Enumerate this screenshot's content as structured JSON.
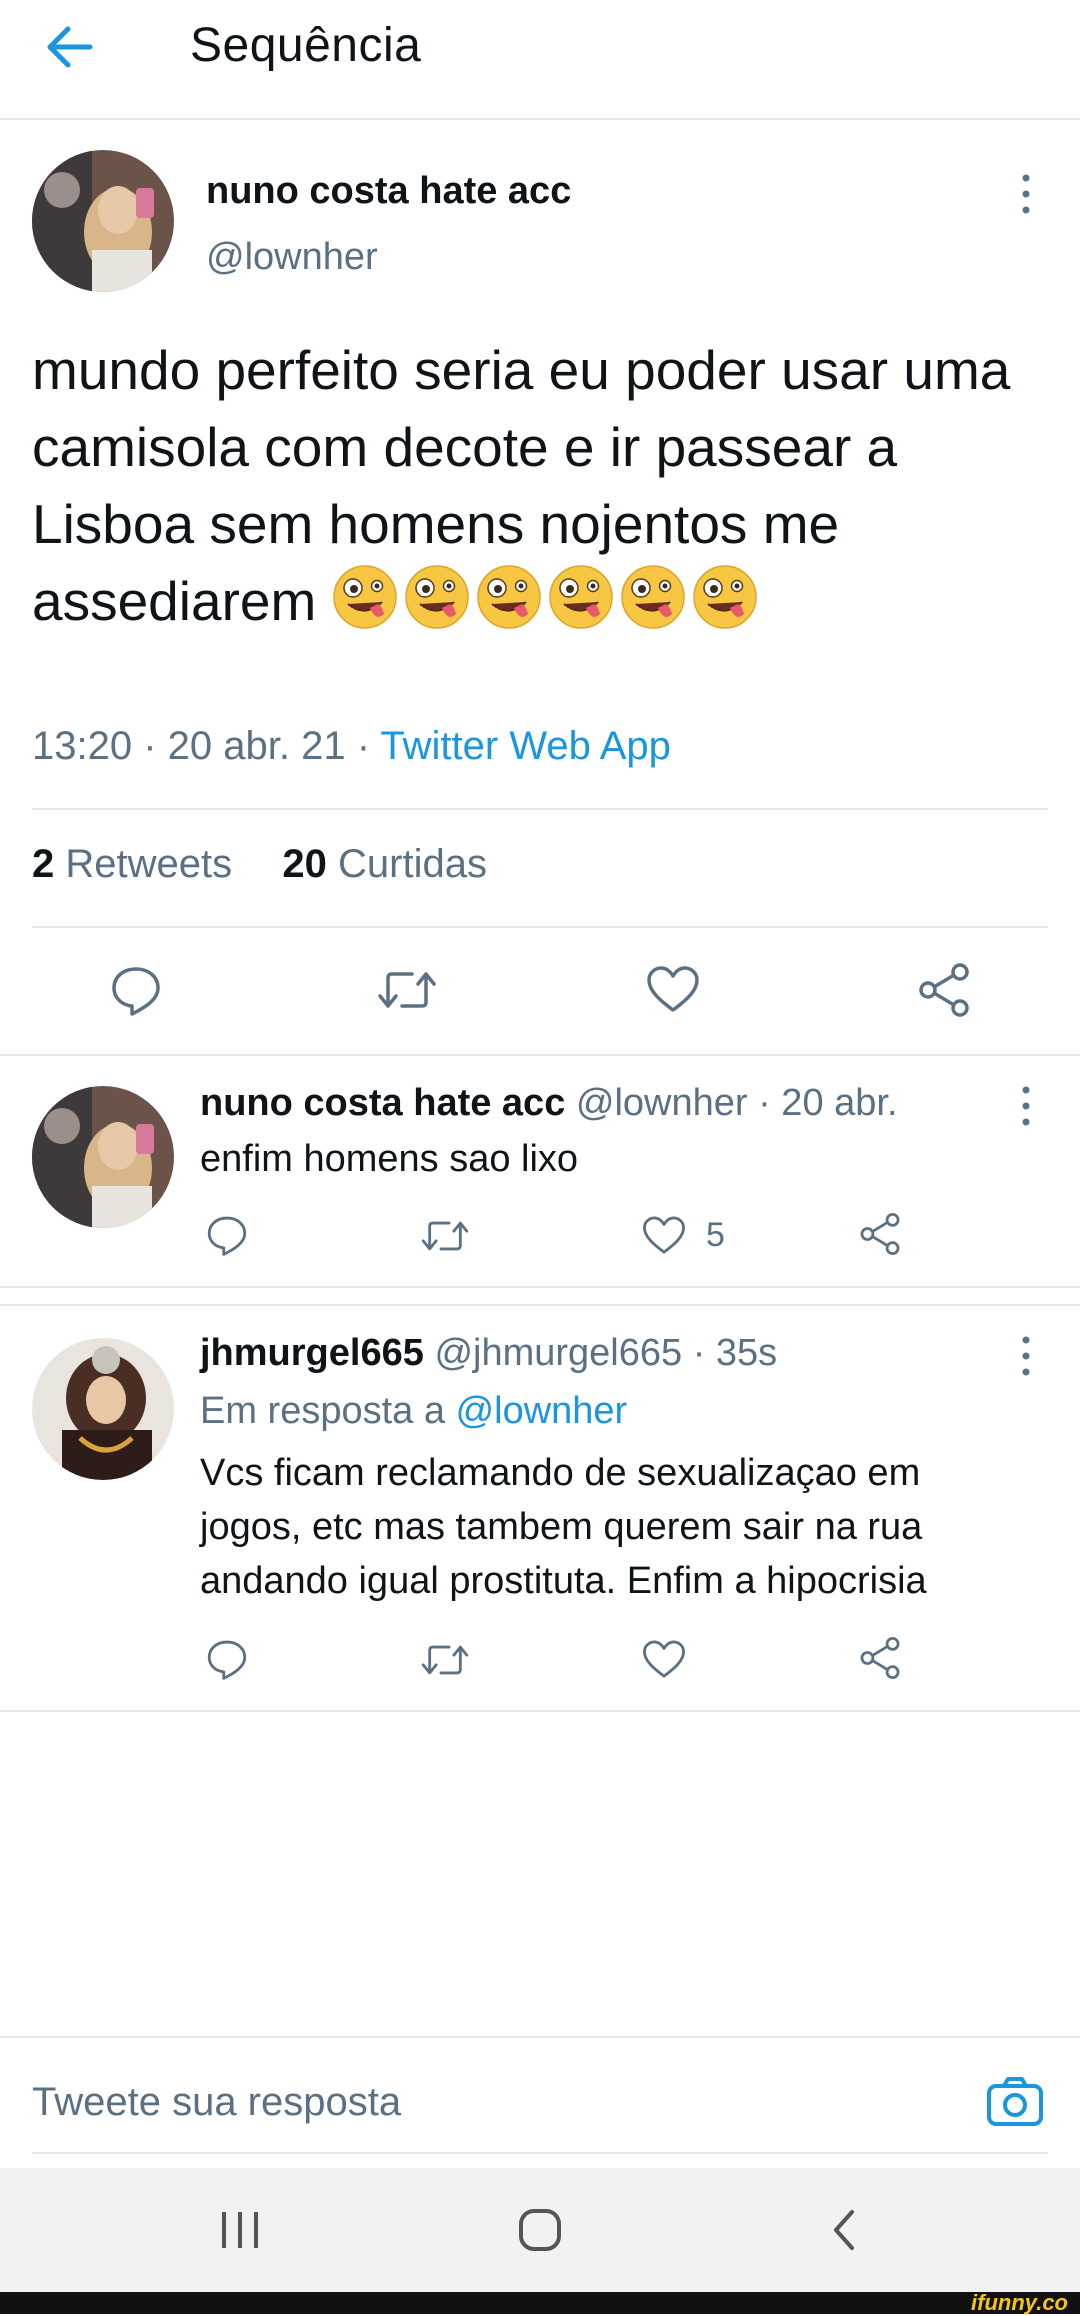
{
  "header": {
    "title": "Sequência"
  },
  "main_tweet": {
    "display_name": "nuno costa hate acc",
    "handle": "@lownher",
    "text": "mundo perfeito seria eu poder usar uma camisola com decote e ir passear a Lisboa sem homens nojentos me assediarem",
    "emoji_name": "zany-face-emoji",
    "emoji_count": 6,
    "timestamp": "13:20 · 20 abr. 21 · ",
    "source": "Twitter Web App",
    "retweets_count": "2",
    "retweets_label": "Retweets",
    "likes_count": "20",
    "likes_label": "Curtidas"
  },
  "reply1": {
    "display_name": "nuno costa hate acc",
    "handle_time": "@lownher · 20 abr.",
    "text": "enfim homens sao lixo",
    "like_count": "5"
  },
  "reply2": {
    "display_name": "jhmurgel665",
    "handle_time": "@jhmurgel665 · 35s",
    "in_reply_prefix": "Em resposta a ",
    "in_reply_handle": "@lownher",
    "text": "Vcs ficam reclamando de sexualizaçao em jogos, etc mas tambem querem sair na rua andando igual prostituta. Enfim a hipocrisia"
  },
  "compose": {
    "placeholder": "Tweete sua resposta"
  },
  "watermark": {
    "text": "ifunny.co"
  },
  "colors": {
    "accent": "#1b95e0",
    "muted": "#5b7083",
    "divider": "#e1e8ed"
  }
}
